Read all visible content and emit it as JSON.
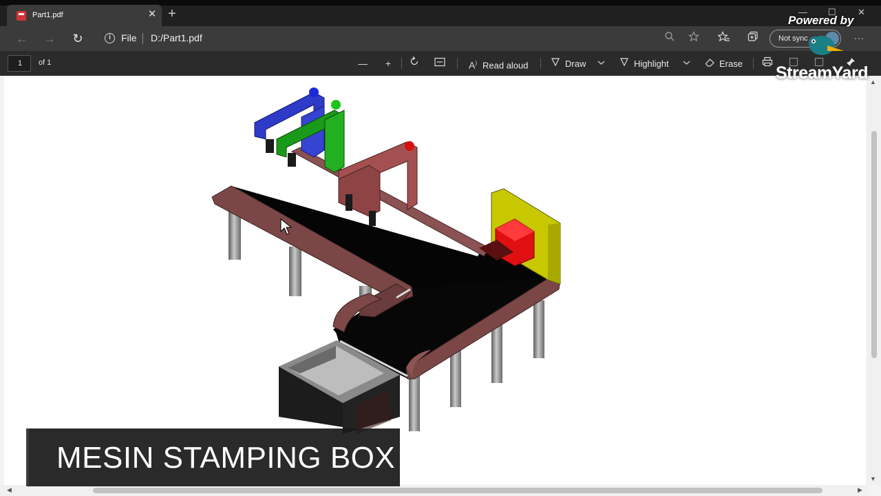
{
  "tab": {
    "title": "Part1.pdf",
    "close": "✕",
    "new_tab": "+"
  },
  "window_controls": {
    "minimize": "—",
    "maximize": "☐",
    "close": "✕"
  },
  "address_bar": {
    "back": "←",
    "forward": "→",
    "refresh": "↻",
    "info": "i",
    "scheme": "File",
    "url": "D:/Part1.pdf",
    "sync_label": "Not sync",
    "more": "···"
  },
  "pdf_toolbar": {
    "page_number": "1",
    "page_count_label": "of 1",
    "zoom_out": "—",
    "zoom_in": "+",
    "read_aloud": "Read aloud",
    "draw": "Draw",
    "highlight": "Highlight",
    "erase": "Erase"
  },
  "caption": {
    "text": "MESIN STAMPING BOX"
  },
  "overlay": {
    "powered_by": "Powered by",
    "brand": "StreamYard"
  },
  "colors": {
    "conveyor_frame": "#7a4646",
    "belt": "#050505",
    "blue_arm": "#2e3ac8",
    "green_arm": "#1a9a1a",
    "red_arm": "#9a4a4a",
    "yellow_plate": "#c8c800",
    "red_block": "#e01010",
    "legs": "#8a8a8a"
  }
}
